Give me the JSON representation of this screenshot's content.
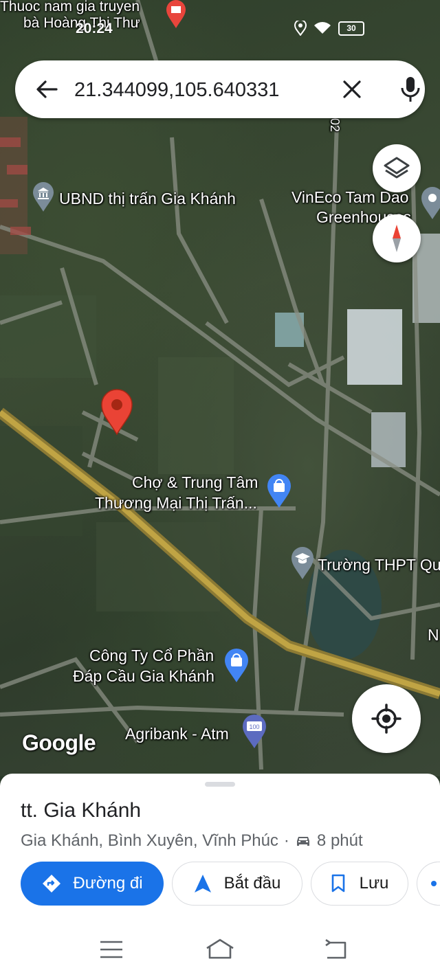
{
  "status_bar": {
    "time": "20:24",
    "battery": "30",
    "notification_text_line1": "Thuoc nam gia truyen",
    "notification_text_line2": "bà Hoàng Thị Thư"
  },
  "search": {
    "query": "21.344099,105.640331"
  },
  "map": {
    "labels": {
      "ubnd": "UBND thị trấn Gia Khánh",
      "vineco_line1": "VinEco Tam Dao",
      "vineco_line2": "Greenhouses",
      "cho_line1": "Chợ & Trung Tâm",
      "cho_line2": "Thương Mại Thị Trấn...",
      "truong": "Trường THPT Qu",
      "congty_line1": "Công Ty Cổ Phần",
      "congty_line2": "Đáp Cầu Gia Khánh",
      "agribank": "Agribank - Atm",
      "road_number": "02",
      "edge_letter": "N",
      "atm_badge": "100"
    },
    "google_logo": "Google",
    "icons": {
      "layers": "layers-icon",
      "compass": "compass-icon",
      "my_location": "my-location-icon",
      "pin": "location-pin-icon"
    }
  },
  "place": {
    "name": "tt. Gia Khánh",
    "address": "Gia Khánh, Bình Xuyên, Vĩnh Phúc",
    "separator": "·",
    "drive_time": "8 phút"
  },
  "actions": {
    "directions": "Đường đi",
    "start": "Bắt đầu",
    "save": "Lưu"
  },
  "colors": {
    "accent_blue": "#1a73e8",
    "pin_red": "#ea4335",
    "road_yellow": "#b59a3e"
  }
}
